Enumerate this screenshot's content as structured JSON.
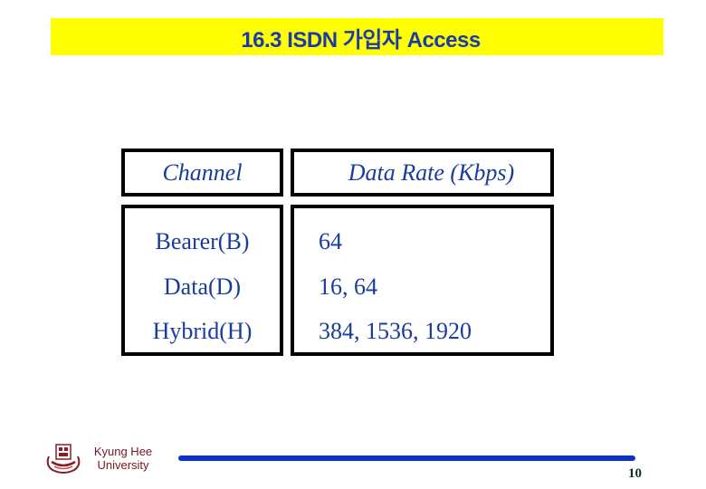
{
  "slide": {
    "title": "16.3 ISDN 가입자 Access",
    "page_number": "10"
  },
  "table": {
    "headers": [
      "Channel",
      "Data Rate (Kbps)"
    ],
    "rows": [
      {
        "channel": "Bearer(B)",
        "rate": "64"
      },
      {
        "channel": "Data(D)",
        "rate": "16, 64"
      },
      {
        "channel": "Hybrid(H)",
        "rate": "384, 1536, 1920"
      }
    ]
  },
  "footer": {
    "institution_line1": "Kyung Hee",
    "institution_line2": "University",
    "logo_icon": "university-crest-icon"
  },
  "colors": {
    "title_bg": "#ffff00",
    "title_text": "#1a3ca6",
    "body_text": "#1a3c9c",
    "footer_bar": "#0a33cc",
    "institution_text": "#7a1422"
  }
}
